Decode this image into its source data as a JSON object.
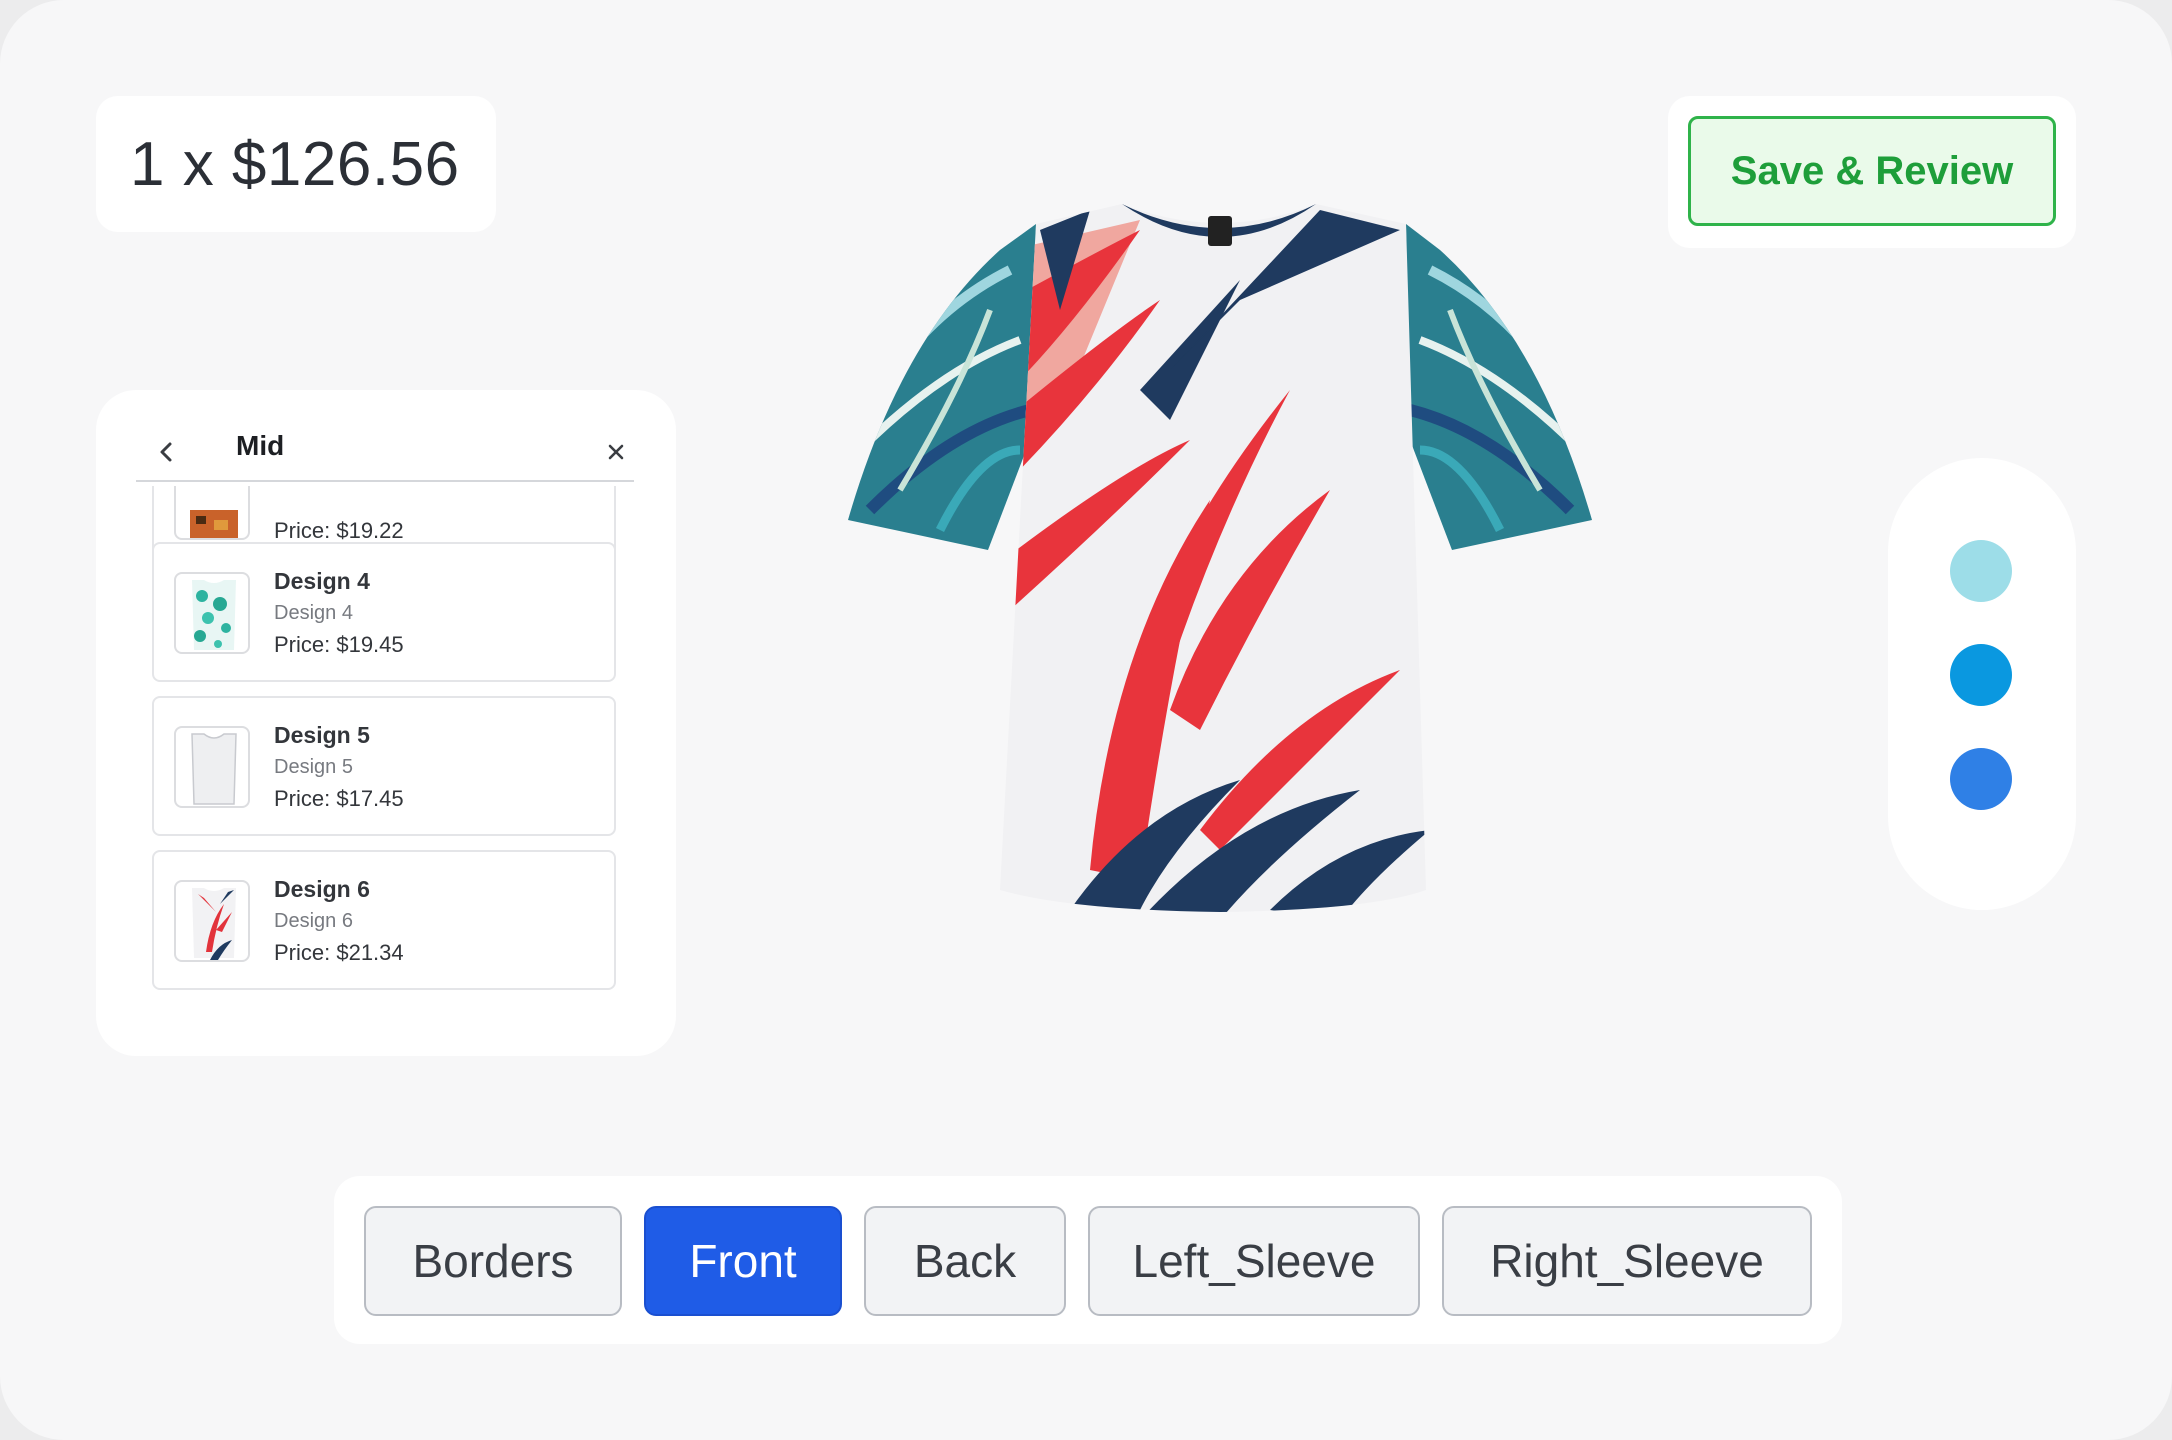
{
  "price": {
    "display": "1 x $126.56"
  },
  "save_button": {
    "label": "Save & Review"
  },
  "design_panel": {
    "title": "Mid",
    "partial_item": {
      "price": "Price: $19.22"
    },
    "items": [
      {
        "name": "Design 4",
        "subtitle": "Design 4",
        "price": "Price: $19.45"
      },
      {
        "name": "Design 5",
        "subtitle": "Design 5",
        "price": "Price: $17.45"
      },
      {
        "name": "Design 6",
        "subtitle": "Design 6",
        "price": "Price: $21.34"
      }
    ]
  },
  "colors": {
    "swatches": [
      "#9ddde8",
      "#0a98e0",
      "#2f80e6"
    ],
    "accent": "#1f5ce7",
    "save_green": "#2fb34a"
  },
  "tabs": [
    {
      "label": "Borders",
      "active": false
    },
    {
      "label": "Front",
      "active": true
    },
    {
      "label": "Back",
      "active": false
    },
    {
      "label": "Left_Sleeve",
      "active": false
    },
    {
      "label": "Right_Sleeve",
      "active": false
    }
  ],
  "icons": {
    "back": "chevron-left-icon",
    "close": "close-icon"
  }
}
